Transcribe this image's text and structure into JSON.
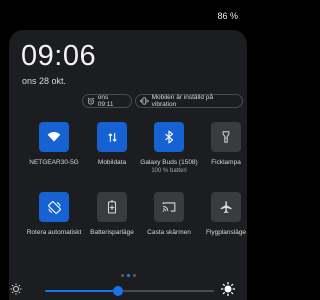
{
  "status": {
    "battery": "86 %"
  },
  "header": {
    "time": "09:06",
    "date": "ons 28 okt."
  },
  "chips": {
    "alarm": "ons 09:11",
    "vibration": "Mobilen är inställd på vibration"
  },
  "tiles": [
    {
      "label": "NETGEAR30-5G",
      "sub": "",
      "icon": "wifi-icon",
      "on": true
    },
    {
      "label": "Mobildata",
      "sub": "",
      "icon": "mobile-data-icon",
      "on": true
    },
    {
      "label": "Galaxy Buds (1508)",
      "sub": "100 % batteri",
      "icon": "bluetooth-icon",
      "on": true
    },
    {
      "label": "Ficklampa",
      "sub": "",
      "icon": "flashlight-icon",
      "on": false
    },
    {
      "label": "Rotera automatiskt",
      "sub": "",
      "icon": "auto-rotate-icon",
      "on": true
    },
    {
      "label": "Batterisparläge",
      "sub": "",
      "icon": "battery-saver-icon",
      "on": false
    },
    {
      "label": "Casta skärmen",
      "sub": "",
      "icon": "cast-icon",
      "on": false
    },
    {
      "label": "Flygplansläge",
      "sub": "",
      "icon": "airplane-icon",
      "on": false
    }
  ],
  "pager": {
    "pages": 3,
    "current": 1
  },
  "brightness": {
    "level": 0.43
  },
  "colors": {
    "accent": "#1662d2",
    "tile_off": "#3a3b3f",
    "panel": "#1c1d20"
  }
}
